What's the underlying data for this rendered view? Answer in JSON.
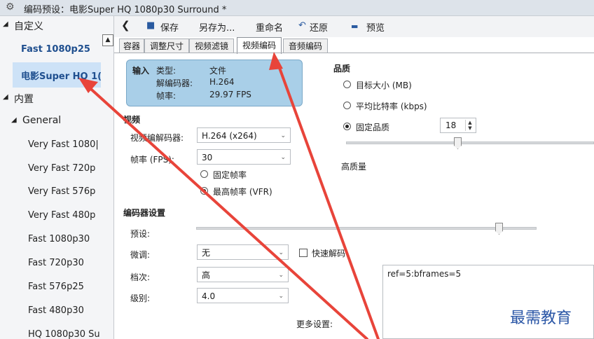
{
  "window": {
    "title": "编码预设：电影Super HQ 1080p30 Surround *"
  },
  "sidebar": {
    "custom_group": "自定义",
    "custom_items": [
      "Fast 1080p25",
      "电影Super HQ 1("
    ],
    "builtin_group": "内置",
    "general_group": "General",
    "general_items": [
      "Very Fast 1080|",
      "Very Fast 720p",
      "Very Fast 576p",
      "Very Fast 480p",
      "Fast 1080p30",
      "Fast 720p30",
      "Fast 576p25",
      "Fast 480p30",
      "HQ 1080p30 Su"
    ]
  },
  "toolbar": {
    "back": "❮",
    "save": "保存",
    "save_as": "另存为...",
    "rename": "重命名",
    "restore": "还原",
    "preview": "预览"
  },
  "tabs": [
    "容器",
    "调整尺寸",
    "视频滤镜",
    "视频编码",
    "音频编码"
  ],
  "active_tab": "视频编码",
  "input_info": {
    "heading": "输入",
    "type_label": "类型:",
    "type_value": "文件",
    "codec_label": "解编码器:",
    "codec_value": "H.264",
    "fps_label": "帧率:",
    "fps_value": "29.97 FPS"
  },
  "video": {
    "section_label": "视频",
    "codec_label": "视频编解码器:",
    "codec_value": "H.264 (x264)",
    "fps_label": "帧率 (FPS):",
    "fps_value": "30",
    "fixed_fps": "固定帧率",
    "peak_fps": "最高帧率 (VFR)"
  },
  "quality": {
    "section_label": "品质",
    "target_size": "目标大小 (MB)",
    "avg_bitrate": "平均比特率 (kbps)",
    "constant_quality": "固定品质",
    "cq_value": "18",
    "high_quality_label": "高质量",
    "slider_level_fraction": 0.45
  },
  "encoder": {
    "section_label": "编码器设置",
    "preset_label": "预设:",
    "tune_label": "微调:",
    "tune_value": "无",
    "fast_decode": "快速解码",
    "profile_label": "档次:",
    "profile_value": "高",
    "level_label": "级别:",
    "level_value": "4.0",
    "more_settings_label": "更多设置:",
    "more_settings_text": "ref=5:bframes=5",
    "preset_level_fraction": 0.89
  },
  "watermark": "最需教育",
  "colors": {
    "annotation_arrow": "#e8443a",
    "info_box": "#a9cfe8",
    "selected_item": "#cde2f7"
  }
}
